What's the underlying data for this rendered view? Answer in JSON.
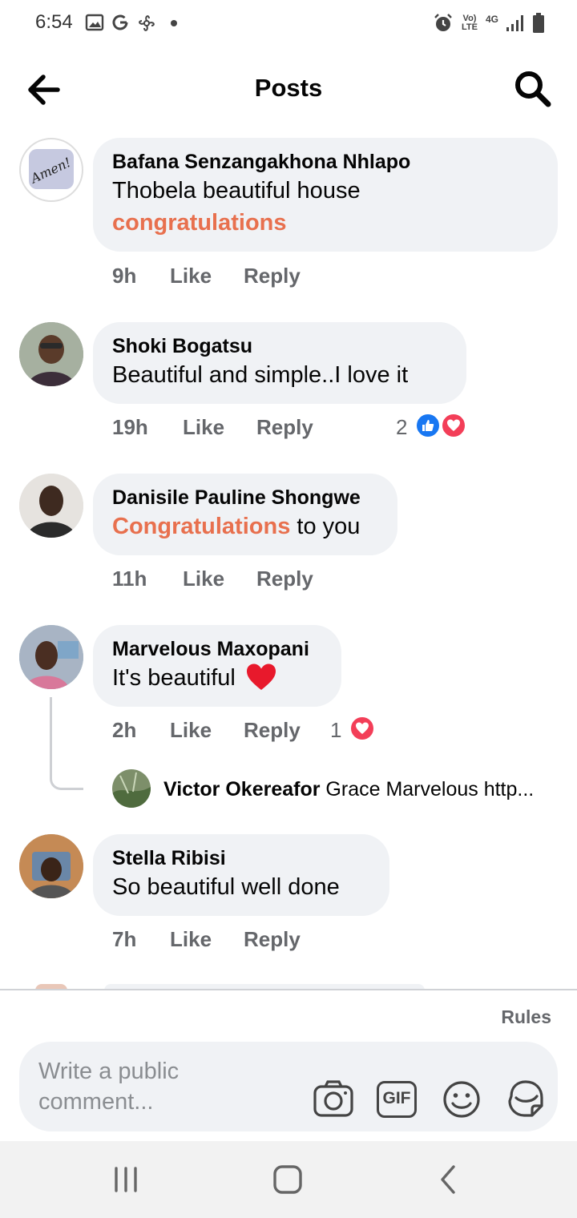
{
  "status_bar": {
    "time": "6:54",
    "network_text": "4G",
    "volte_text": "Vo) LTE",
    "left_icons": [
      "gallery-icon",
      "google-icon",
      "fan-icon",
      "dot-icon"
    ],
    "right_icons": [
      "alarm-icon",
      "volte-icon",
      "network-4g-icon",
      "signal-icon",
      "battery-icon"
    ]
  },
  "header": {
    "title": "Posts",
    "back_icon": "arrow-left-icon",
    "search_icon": "search-icon"
  },
  "comments": [
    {
      "author": "Bafana Senzangakhona Nhlapo",
      "line1": "Thobela beautiful house",
      "line2_highlight": "congratulations",
      "time": "9h",
      "like": "Like",
      "reply": "Reply"
    },
    {
      "author": "Shoki Bogatsu",
      "line1": "Beautiful and simple..I love it",
      "time": "19h",
      "like": "Like",
      "reply": "Reply",
      "reaction_count": "2",
      "reactions": [
        "like-reaction-icon",
        "love-reaction-icon"
      ]
    },
    {
      "author": "Danisile Pauline Shongwe",
      "line1_highlight": "Congratulations",
      "line1_rest": " to you",
      "time": "11h",
      "like": "Like",
      "reply": "Reply"
    },
    {
      "author": "Marvelous Maxopani",
      "line1": "It's beautiful",
      "time": "2h",
      "like": "Like",
      "reply": "Reply",
      "reaction_count": "1",
      "reactions": [
        "love-reaction-icon"
      ],
      "reply_preview": {
        "author": "Victor Okereafor",
        "text": "Grace Marvelous http..."
      }
    },
    {
      "author": "Stella Ribisi",
      "line1": "So beautiful well done",
      "time": "7h",
      "like": "Like",
      "reply": "Reply"
    }
  ],
  "composer": {
    "rules": "Rules",
    "placeholder": "Write a public comment...",
    "gif_label": "GIF",
    "tools": [
      "camera-icon",
      "gif-icon",
      "emoji-icon",
      "sticker-icon"
    ]
  },
  "navbar": {
    "buttons": [
      "recent-apps-icon",
      "home-icon",
      "back-nav-icon"
    ]
  },
  "colors": {
    "bubble": "#f0f2f5",
    "highlight": "#e8704e",
    "meta": "#65676b",
    "like_blue": "#1877f2",
    "love_red": "#f33e58"
  }
}
